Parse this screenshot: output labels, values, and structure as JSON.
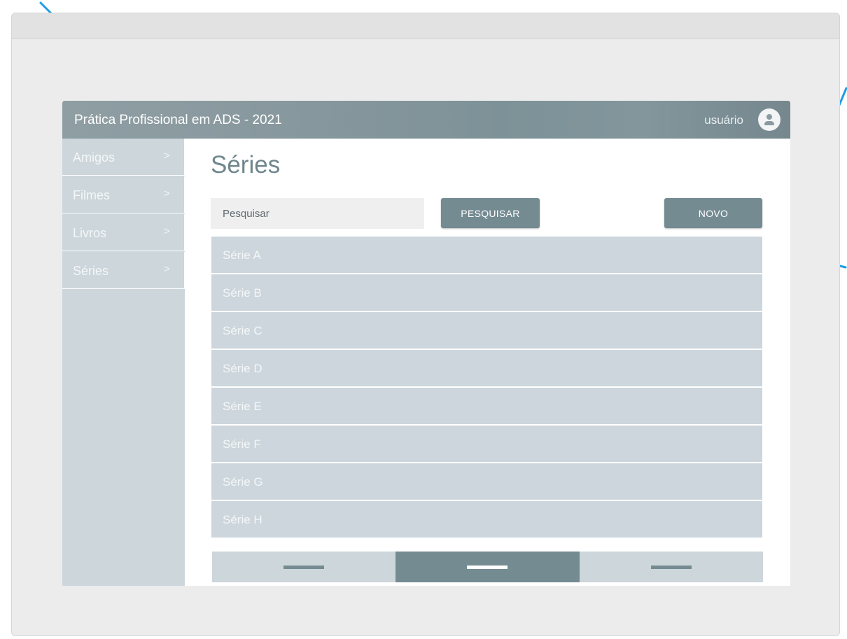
{
  "app": {
    "title": "Prática Profissional em ADS - 2021",
    "user_label": "usuário"
  },
  "sidebar": {
    "items": [
      {
        "label": "Amigos",
        "chevron": ">"
      },
      {
        "label": "Filmes",
        "chevron": ">"
      },
      {
        "label": "Livros",
        "chevron": ">"
      },
      {
        "label": "Séries",
        "chevron": ">"
      }
    ]
  },
  "main": {
    "title": "Séries",
    "search_placeholder": "Pesquisar",
    "search_value": "",
    "search_button": "PESQUISAR",
    "new_button": "NOVO",
    "list": [
      "Série A",
      "Série B",
      "Série C",
      "Série D",
      "Série E",
      "Série F",
      "Série G",
      "Série H"
    ],
    "pagination": {
      "pages": 3,
      "active_index": 1
    }
  },
  "colors": {
    "accent": "#748b92",
    "list_bg": "#ccd6dc",
    "sidebar_bg": "#ccd6db",
    "deco_line": "#1e9be6"
  },
  "icons": {
    "avatar": "user-avatar-icon",
    "chevron": "chevron-right-icon"
  }
}
